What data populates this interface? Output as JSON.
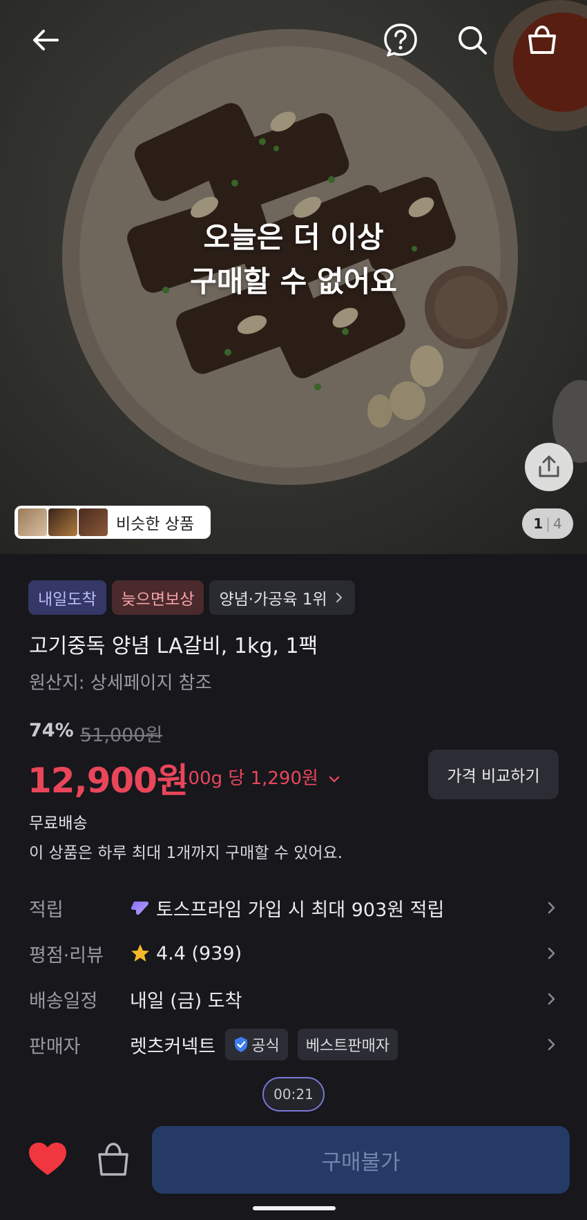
{
  "hero": {
    "overlay_line1": "오늘은 더 이상",
    "overlay_line2": "구매할 수 없어요",
    "pager_current": "1",
    "pager_total": "4",
    "similar_label": "비슷한 상품",
    "icons": [
      "back-arrow-icon",
      "help-icon",
      "search-icon",
      "shopping-bag-icon",
      "share-icon"
    ]
  },
  "tags": [
    {
      "label": "내일도착",
      "style": "blue"
    },
    {
      "label": "늦으면보상",
      "style": "red"
    },
    {
      "label": "양념·가공육 1위",
      "style": "gray"
    }
  ],
  "product": {
    "title": "고기중독 양념 LA갈비, 1kg, 1팩",
    "origin": "원산지: 상세페이지 참조",
    "discount": "74%",
    "original_price": "51,000원",
    "price": "12,900원",
    "unit_price": "100g 당 1,290원",
    "compare_label": "가격 비교하기",
    "shipping": "무료배송",
    "purchase_limit": "이 상품은 하루 최대 1개까지 구매할 수 있어요."
  },
  "info": {
    "reward_label": "적립",
    "reward_value": "토스프라임 가입 시 최대 903원 적립",
    "rating_label": "평점·리뷰",
    "rating_value": "4.4 (939)",
    "delivery_label": "배송일정",
    "delivery_value": "내일 (금) 도착",
    "seller_label": "판매자",
    "seller_name": "렛츠커넥트",
    "seller_badge_official": "공식",
    "seller_badge_best": "베스트판매자"
  },
  "timer": "00:21",
  "bottom": {
    "buy_label": "구매불가",
    "wishlist_active": true
  },
  "colors": {
    "background": "#17171c",
    "price_red": "#e9465a",
    "wishlist_red": "#f0363f",
    "buy_button": "#253b66",
    "tag_blue_bg": "#353766",
    "tag_red_bg": "#4a2a2d"
  }
}
